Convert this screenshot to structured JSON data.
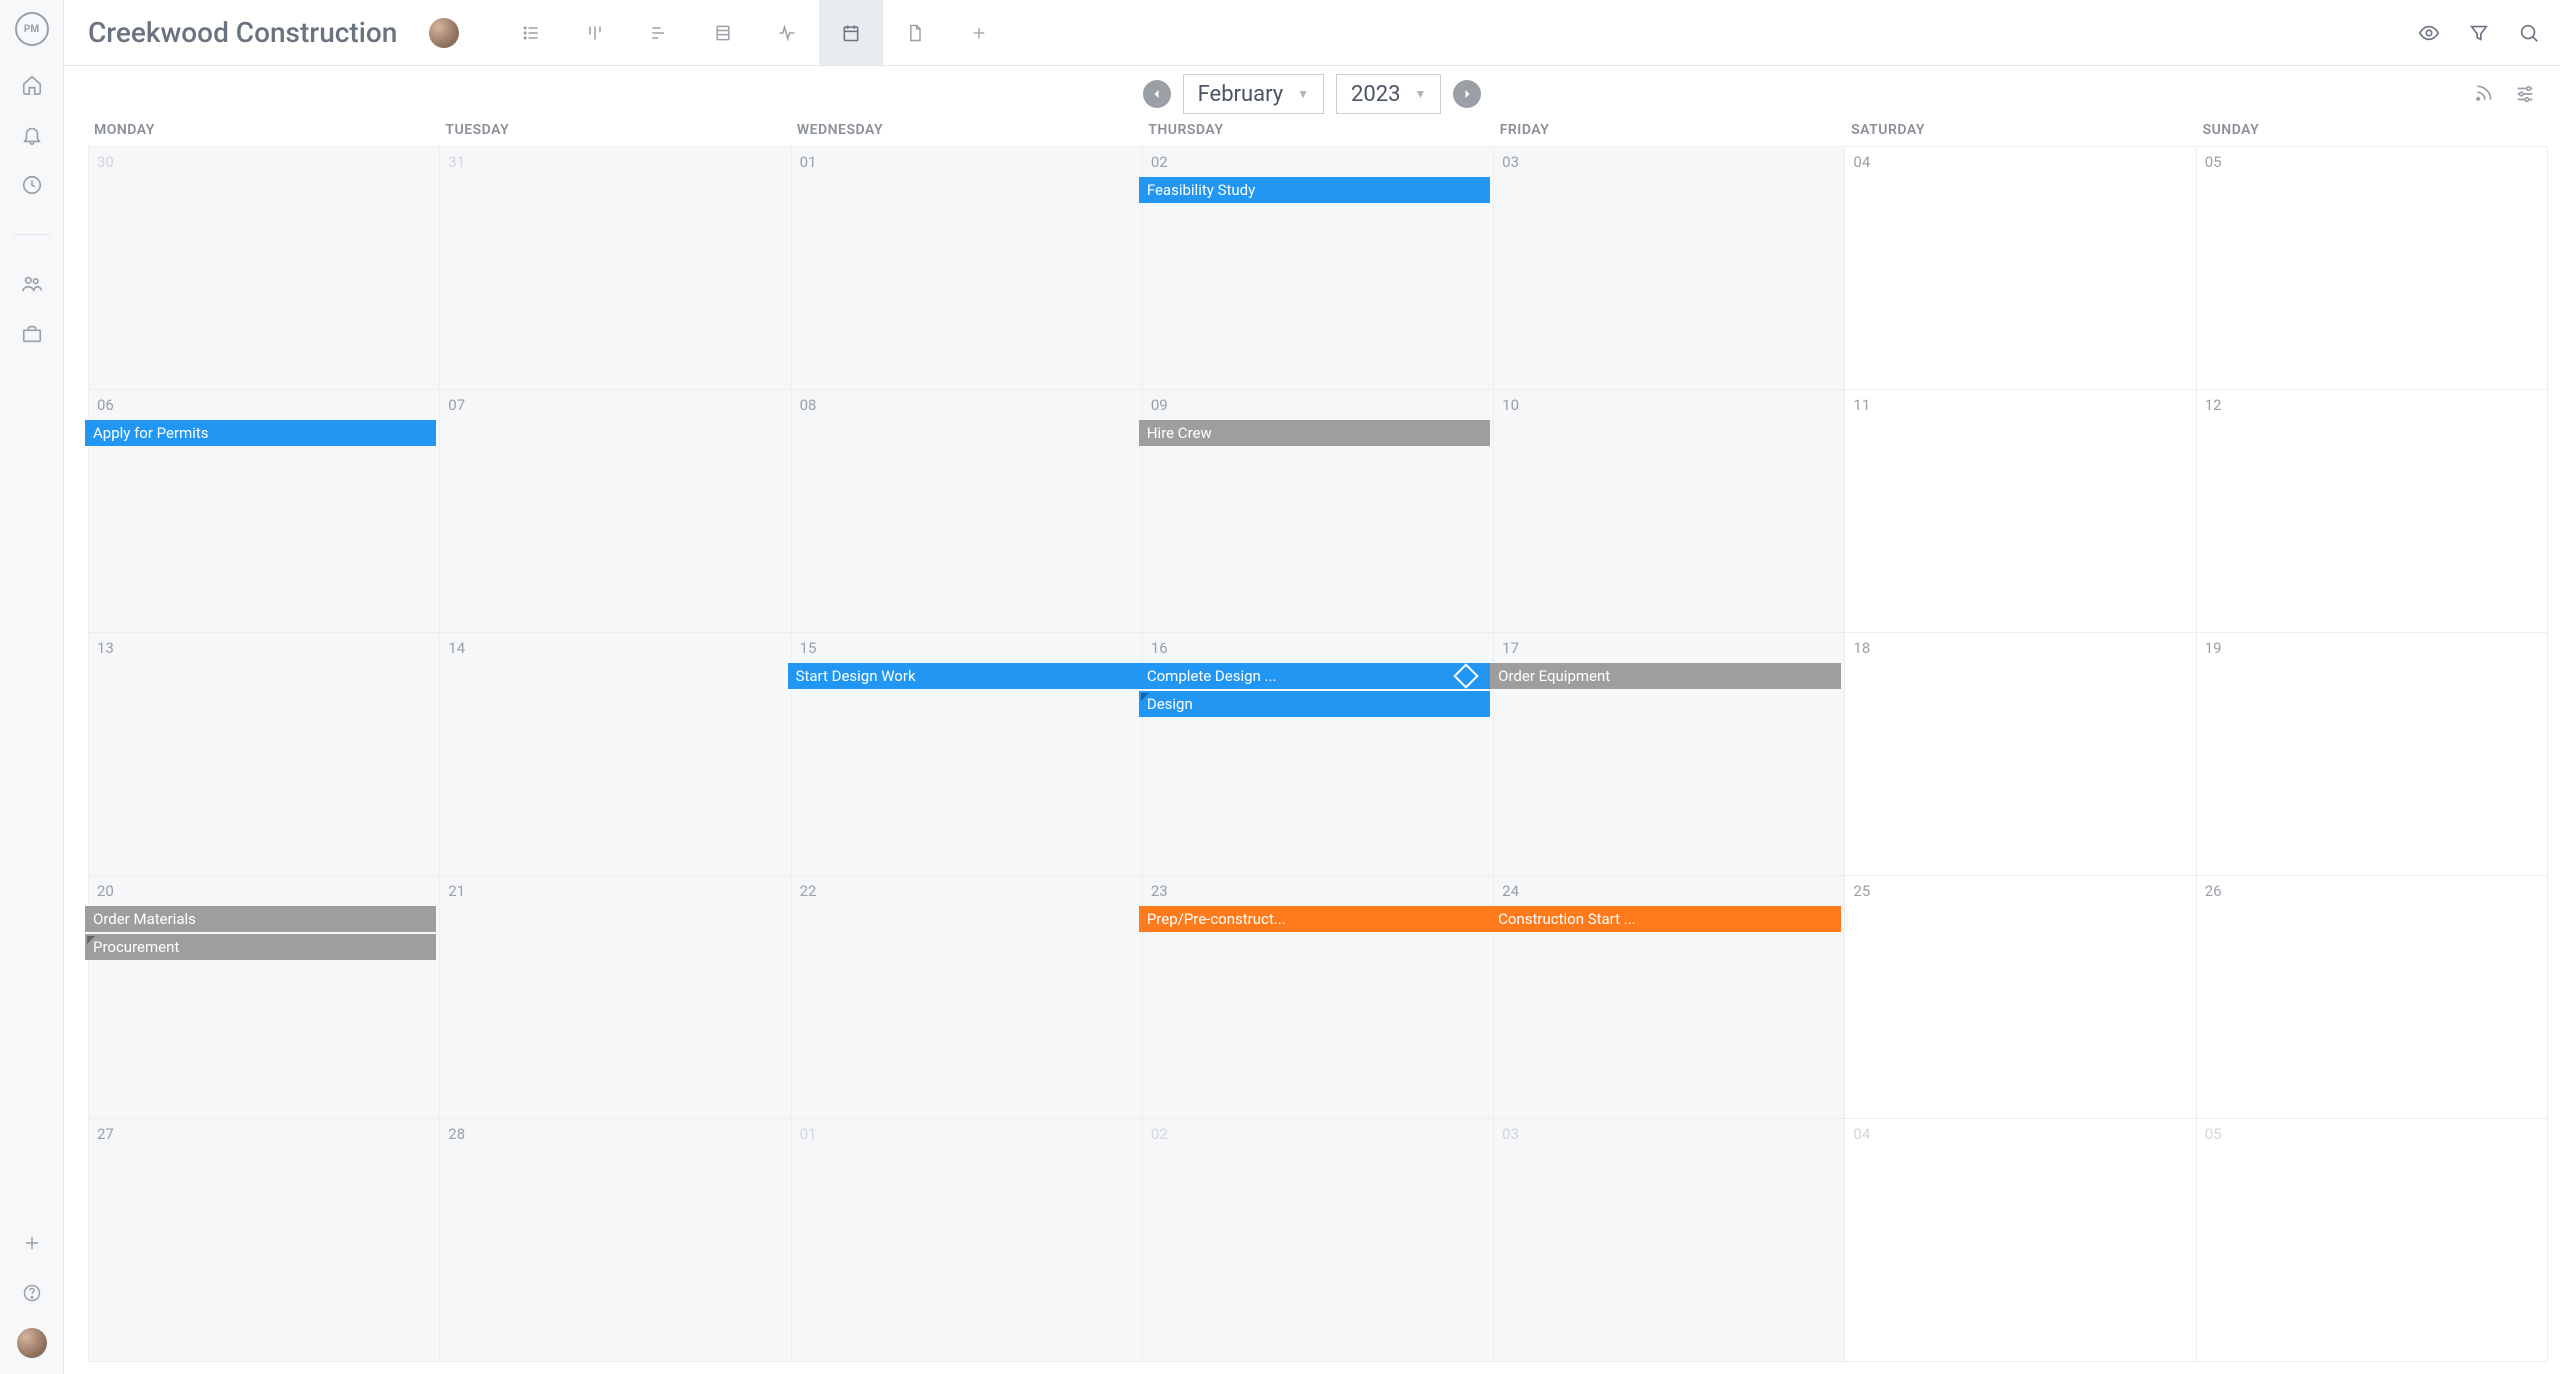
{
  "app": {
    "logo_text": "PM"
  },
  "project": {
    "title": "Creekwood Construction"
  },
  "rail_icons": [
    "home",
    "bell",
    "clock",
    "people",
    "briefcase"
  ],
  "view_tabs": [
    {
      "name": "list",
      "active": false
    },
    {
      "name": "board",
      "active": false
    },
    {
      "name": "gantt",
      "active": false
    },
    {
      "name": "sheet",
      "active": false
    },
    {
      "name": "activity",
      "active": false
    },
    {
      "name": "calendar",
      "active": true
    },
    {
      "name": "file",
      "active": false
    },
    {
      "name": "add",
      "active": false
    }
  ],
  "date_picker": {
    "month": "February",
    "year": "2023"
  },
  "days_of_week": [
    "MONDAY",
    "TUESDAY",
    "WEDNESDAY",
    "THURSDAY",
    "FRIDAY",
    "SATURDAY",
    "SUNDAY"
  ],
  "weeks": [
    [
      {
        "n": "30",
        "outside": true,
        "weekend": false
      },
      {
        "n": "31",
        "outside": true,
        "weekend": false
      },
      {
        "n": "01",
        "outside": false,
        "weekend": false
      },
      {
        "n": "02",
        "outside": false,
        "weekend": false
      },
      {
        "n": "03",
        "outside": false,
        "weekend": false
      },
      {
        "n": "04",
        "outside": false,
        "weekend": true
      },
      {
        "n": "05",
        "outside": false,
        "weekend": true
      }
    ],
    [
      {
        "n": "06",
        "outside": false,
        "weekend": false
      },
      {
        "n": "07",
        "outside": false,
        "weekend": false
      },
      {
        "n": "08",
        "outside": false,
        "weekend": false
      },
      {
        "n": "09",
        "outside": false,
        "weekend": false
      },
      {
        "n": "10",
        "outside": false,
        "weekend": false
      },
      {
        "n": "11",
        "outside": false,
        "weekend": true
      },
      {
        "n": "12",
        "outside": false,
        "weekend": true
      }
    ],
    [
      {
        "n": "13",
        "outside": false,
        "weekend": false
      },
      {
        "n": "14",
        "outside": false,
        "weekend": false
      },
      {
        "n": "15",
        "outside": false,
        "weekend": false
      },
      {
        "n": "16",
        "outside": false,
        "weekend": false
      },
      {
        "n": "17",
        "outside": false,
        "weekend": false
      },
      {
        "n": "18",
        "outside": false,
        "weekend": true
      },
      {
        "n": "19",
        "outside": false,
        "weekend": true
      }
    ],
    [
      {
        "n": "20",
        "outside": false,
        "weekend": false
      },
      {
        "n": "21",
        "outside": false,
        "weekend": false
      },
      {
        "n": "22",
        "outside": false,
        "weekend": false
      },
      {
        "n": "23",
        "outside": false,
        "weekend": false
      },
      {
        "n": "24",
        "outside": false,
        "weekend": false
      },
      {
        "n": "25",
        "outside": false,
        "weekend": true
      },
      {
        "n": "26",
        "outside": false,
        "weekend": true
      }
    ],
    [
      {
        "n": "27",
        "outside": false,
        "weekend": false
      },
      {
        "n": "28",
        "outside": false,
        "weekend": false
      },
      {
        "n": "01",
        "outside": true,
        "weekend": false
      },
      {
        "n": "02",
        "outside": true,
        "weekend": false
      },
      {
        "n": "03",
        "outside": true,
        "weekend": false
      },
      {
        "n": "04",
        "outside": true,
        "weekend": true
      },
      {
        "n": "05",
        "outside": true,
        "weekend": true
      }
    ]
  ],
  "events": [
    {
      "label": "Feasibility Study",
      "color": "blue",
      "row": 0,
      "colStart": 3,
      "colEnd": 4,
      "lane": 0,
      "milestone": false,
      "notch": false
    },
    {
      "label": "Apply for Permits",
      "color": "blue",
      "row": 1,
      "colStart": 0,
      "colEnd": 1,
      "lane": 0,
      "milestone": false,
      "notch": false
    },
    {
      "label": "Hire Crew",
      "color": "gray",
      "row": 1,
      "colStart": 3,
      "colEnd": 4,
      "lane": 0,
      "milestone": false,
      "notch": false
    },
    {
      "label": "Start Design Work",
      "color": "blue",
      "row": 2,
      "colStart": 2,
      "colEnd": 3,
      "lane": 0,
      "milestone": false,
      "notch": false
    },
    {
      "label": "Complete Design ...",
      "color": "blue",
      "row": 2,
      "colStart": 3,
      "colEnd": 4,
      "lane": 0,
      "milestone": true,
      "notch": false
    },
    {
      "label": "Order Equipment",
      "color": "gray",
      "row": 2,
      "colStart": 4,
      "colEnd": 5,
      "lane": 0,
      "milestone": false,
      "notch": false
    },
    {
      "label": "Design",
      "color": "blue",
      "row": 2,
      "colStart": 3,
      "colEnd": 4,
      "lane": 1,
      "milestone": false,
      "notch": true
    },
    {
      "label": "Order Materials",
      "color": "gray",
      "row": 3,
      "colStart": 0,
      "colEnd": 1,
      "lane": 0,
      "milestone": false,
      "notch": false
    },
    {
      "label": "Procurement",
      "color": "gray",
      "row": 3,
      "colStart": 0,
      "colEnd": 1,
      "lane": 1,
      "milestone": false,
      "notch": true
    },
    {
      "label": "Prep/Pre-construct...",
      "color": "orange",
      "row": 3,
      "colStart": 3,
      "colEnd": 4,
      "lane": 0,
      "milestone": false,
      "notch": false
    },
    {
      "label": "Construction Start ...",
      "color": "orange",
      "row": 3,
      "colStart": 4,
      "colEnd": 5,
      "lane": 0,
      "milestone": false,
      "notch": false
    }
  ]
}
